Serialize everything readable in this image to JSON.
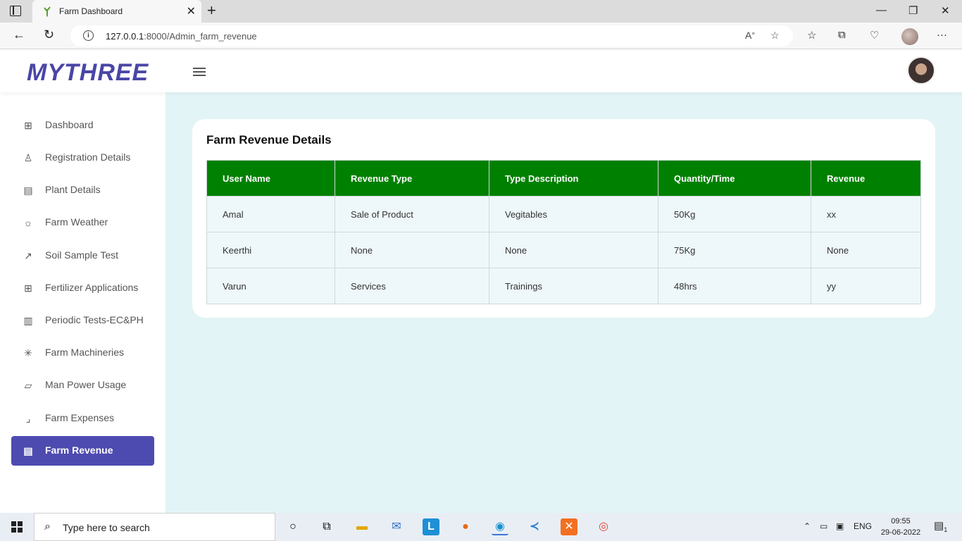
{
  "browser": {
    "tab_title": "Farm Dashboard",
    "url_host": "127.0.0.1",
    "url_rest": ":8000/Admin_farm_revenue"
  },
  "header": {
    "brand": "MYTHREE"
  },
  "sidebar": {
    "items": [
      {
        "label": "Dashboard",
        "icon": "grid-icon"
      },
      {
        "label": "Registration Details",
        "icon": "user-icon"
      },
      {
        "label": "Plant Details",
        "icon": "layout-icon"
      },
      {
        "label": "Farm Weather",
        "icon": "sun-icon"
      },
      {
        "label": "Soil Sample Test",
        "icon": "external-link-icon"
      },
      {
        "label": "Fertilizer Applications",
        "icon": "grid-plus-icon"
      },
      {
        "label": "Periodic Tests-EC&PH",
        "icon": "columns-icon"
      },
      {
        "label": "Farm Machineries",
        "icon": "loader-icon"
      },
      {
        "label": "Man Power Usage",
        "icon": "map-icon"
      },
      {
        "label": "Farm Expenses",
        "icon": "minimize-icon"
      },
      {
        "label": "Farm Revenue",
        "icon": "file-text-icon",
        "active": true
      }
    ]
  },
  "main": {
    "card_title": "Farm Revenue Details",
    "columns": [
      "User Name",
      "Revenue Type",
      "Type Description",
      "Quantity/Time",
      "Revenue"
    ],
    "rows": [
      [
        "Amal",
        "Sale of Product",
        "Vegitables",
        "50Kg",
        "xx"
      ],
      [
        "Keerthi",
        "None",
        "None",
        "75Kg",
        "None"
      ],
      [
        "Varun",
        "Services",
        "Trainings",
        "48hrs",
        "yy"
      ]
    ]
  },
  "taskbar": {
    "search_placeholder": "Type here to search",
    "language": "ENG",
    "time": "09:55",
    "date": "29-06-2022",
    "notification_count": "1"
  },
  "colors": {
    "brand": "#4a46a6",
    "active_nav": "#4e4bb0",
    "table_header": "#008000",
    "main_bg": "#e3f4f6"
  }
}
